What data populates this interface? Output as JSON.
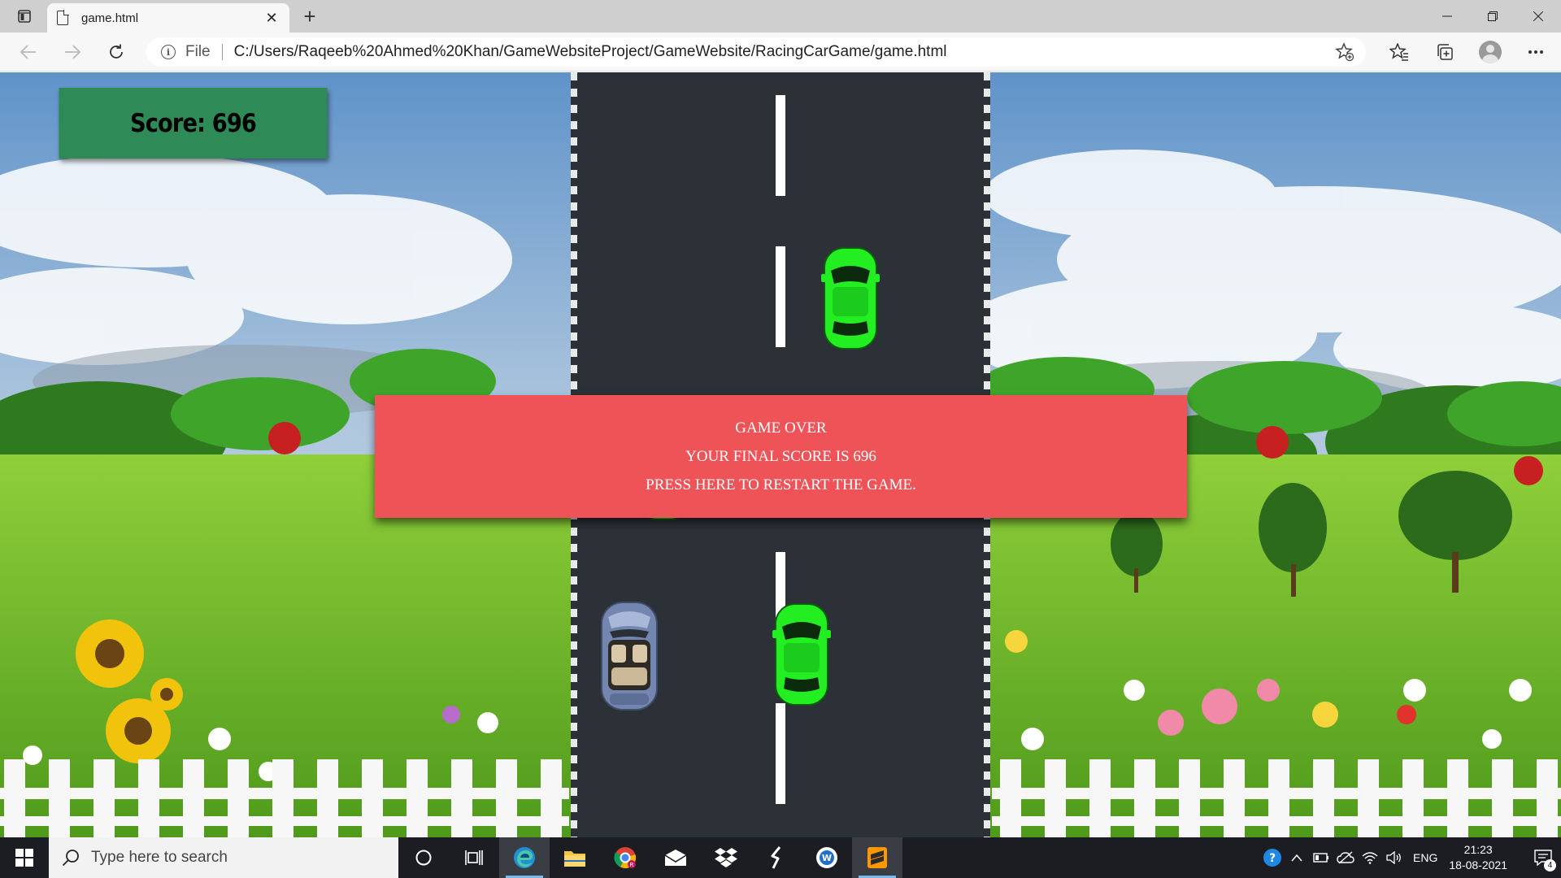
{
  "browser": {
    "tab_title": "game.html",
    "address": {
      "scheme_label": "File",
      "url": "C:/Users/Raqeeb%20Ahmed%20Khan/GameWebsiteProject/GameWebsite/RacingCarGame/game.html"
    }
  },
  "game": {
    "score_text": "Score: 696",
    "gameover": {
      "title": "GAME OVER",
      "final_score": "YOUR FINAL SCORE IS 696",
      "restart": "PRESS HERE TO RESTART THE GAME."
    },
    "colors": {
      "road": "#2b3136",
      "score_box": "#2e8b57",
      "gameover_box": "#ee5358",
      "enemy_car": "#22ee22"
    }
  },
  "taskbar": {
    "search_placeholder": "Type here to search",
    "language": "ENG",
    "time": "21:23",
    "date": "18-08-2021",
    "notification_count": "4"
  }
}
